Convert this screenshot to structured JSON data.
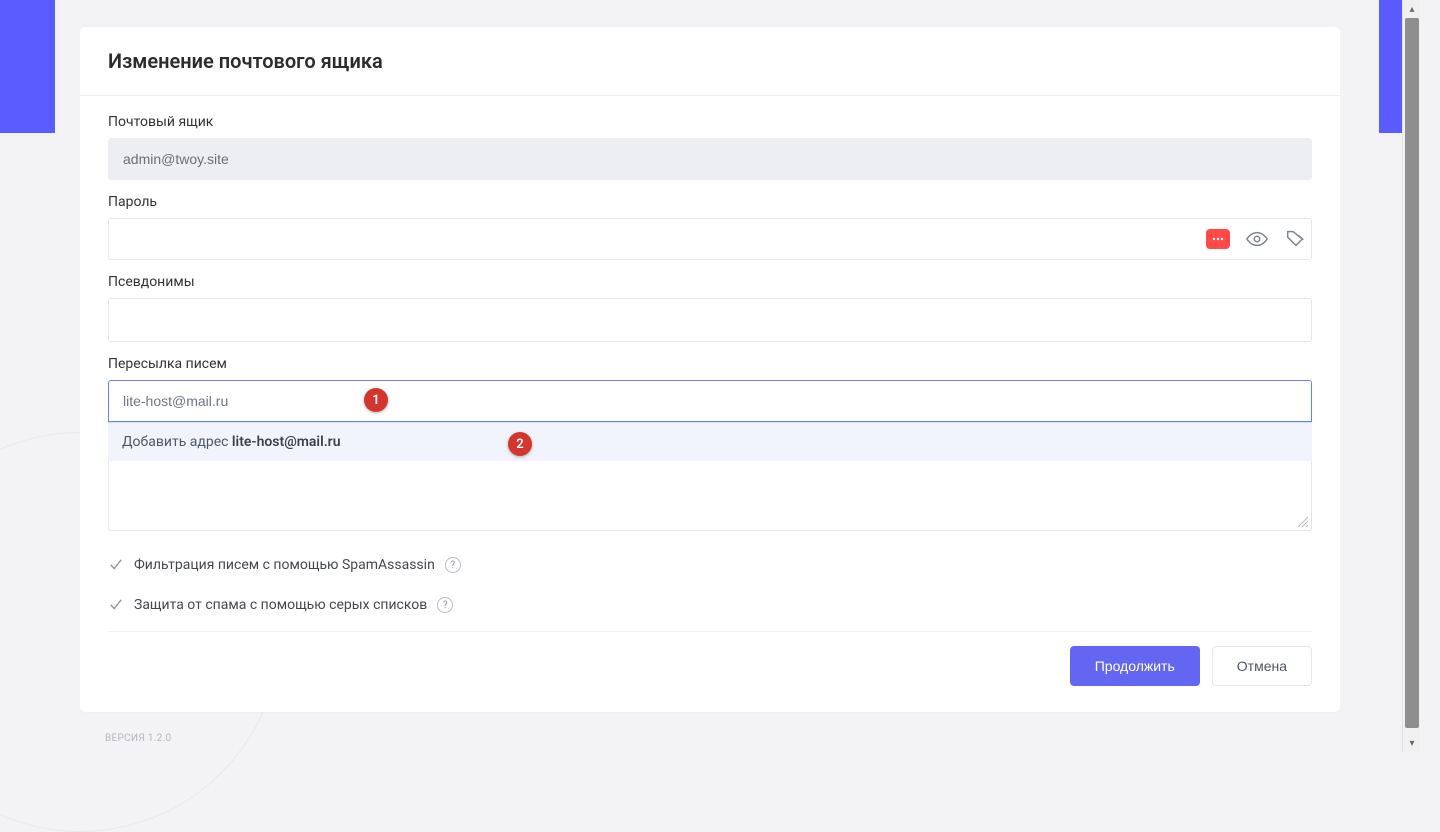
{
  "header": {
    "title": "Изменение почтового ящика"
  },
  "fields": {
    "mailbox": {
      "label": "Почтовый ящик",
      "value": "admin@twoy.site"
    },
    "password": {
      "label": "Пароль",
      "value": ""
    },
    "aliases": {
      "label": "Псевдонимы",
      "value": ""
    },
    "forwarding": {
      "label": "Пересылка писем",
      "value": "lite-host@mail.ru",
      "suggest_prefix": "Добавить адрес ",
      "suggest_value": "lite-host@mail.ru"
    }
  },
  "checks": {
    "spamassassin": "Фильтрация писем с помощью SpamAssassin",
    "greylist": "Защита от спама с помощью серых списков"
  },
  "actions": {
    "submit": "Продолжить",
    "cancel": "Отмена"
  },
  "badges": {
    "one": "1",
    "two": "2"
  },
  "footer": {
    "version": "ВЕРСИЯ 1.2.0"
  }
}
